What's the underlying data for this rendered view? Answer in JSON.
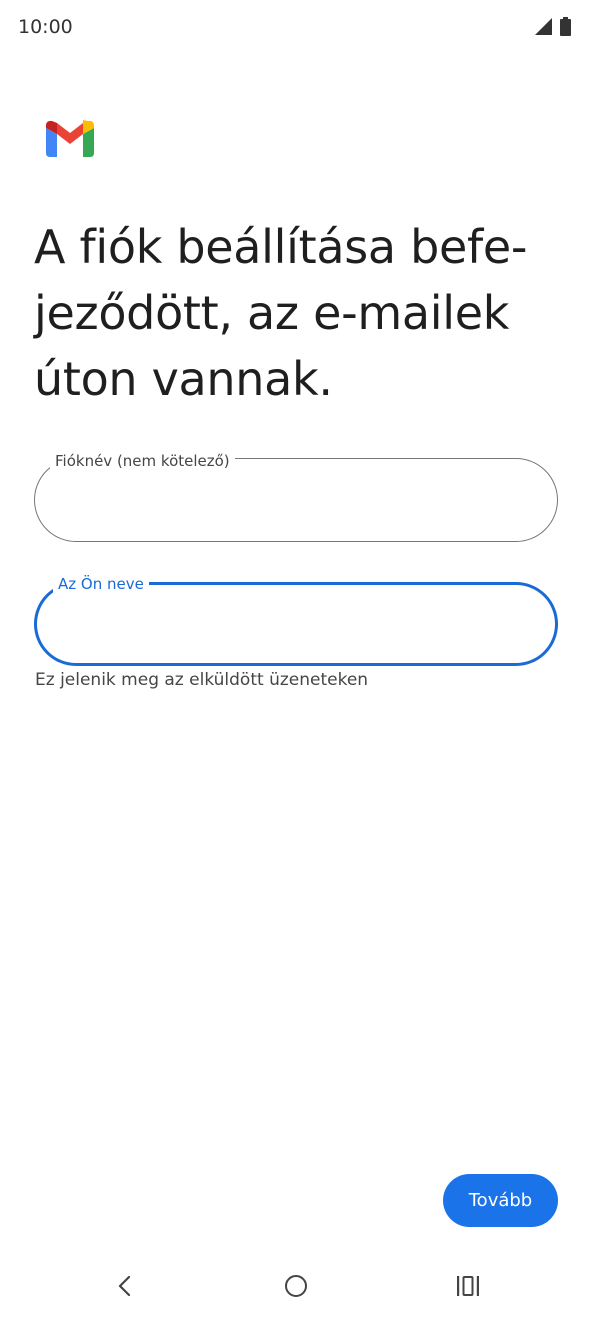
{
  "status_bar": {
    "time": "10:00",
    "icons": [
      "signal-icon",
      "battery-icon"
    ]
  },
  "logo": {
    "icon": "gmail-logo-icon"
  },
  "title": "A fiók beállítása befe-jeződött, az e-mailek úton vannak.",
  "form": {
    "account_name": {
      "label": "Fióknév (nem kötelező)",
      "value": "",
      "state": "default"
    },
    "your_name": {
      "label": "Az Ön neve",
      "value": "",
      "state": "focused",
      "helper": "Ez jelenik meg az elküldött üzeneteken"
    }
  },
  "next_button": {
    "label": "Tovább"
  },
  "nav_bar": {
    "icons": [
      "back-icon",
      "home-icon",
      "recents-icon"
    ]
  },
  "colors": {
    "accent": "#1a73e8",
    "focus_outline": "#1a6bd6",
    "outline": "#747775",
    "text": "#1f1f1f",
    "secondary_text": "#444746",
    "gmail_red": "#ea4335",
    "gmail_blue": "#4285f4",
    "gmail_green": "#34a853",
    "gmail_yellow": "#fbbc04",
    "gmail_dark_red": "#c5221f"
  }
}
